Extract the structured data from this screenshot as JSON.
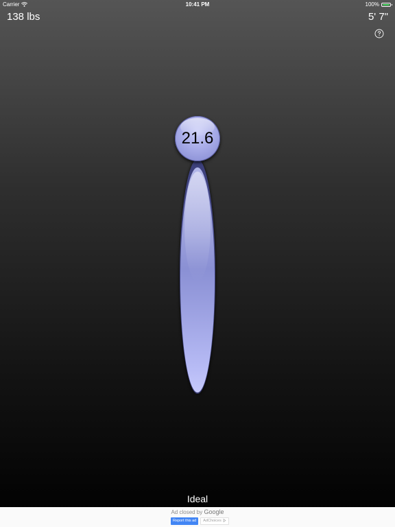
{
  "status_bar": {
    "carrier": "Carrier",
    "time": "10:41 PM",
    "battery": "100%",
    "battery_color": "#4cd964"
  },
  "header": {
    "weight": "138 lbs",
    "height": "5' 7\"",
    "help_icon": "question-circle-icon"
  },
  "gauge": {
    "bmi": "21.6",
    "color": "#a8ace8"
  },
  "result": {
    "category": "Ideal"
  },
  "ad": {
    "closed_text": "Ad closed by",
    "brand": "Google",
    "report_label": "Report this ad",
    "adchoices_label": "AdChoices",
    "report_color": "#4285f4"
  }
}
